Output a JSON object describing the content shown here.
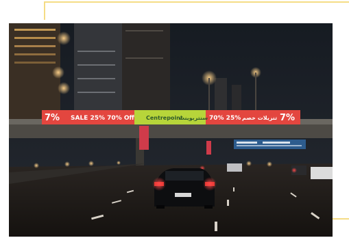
{
  "photo": {
    "description_alt": "",
    "billboard": {
      "left_promo": "SALE 25% 70% Off",
      "left_logo": "7%",
      "center_brand": "Centrepoint",
      "center_arabic": "سنتربوينت",
      "right_promo": "70% 25%",
      "right_arabic": "تنزيلات خصم",
      "right_logo": "7%"
    },
    "colors": {
      "sky": "#1a2029",
      "billboard_red": "#e3463f",
      "billboard_green": "#b7d53a",
      "road_sign_blue": "#2d5c8e",
      "accent_frame": "#f5dc84"
    }
  }
}
